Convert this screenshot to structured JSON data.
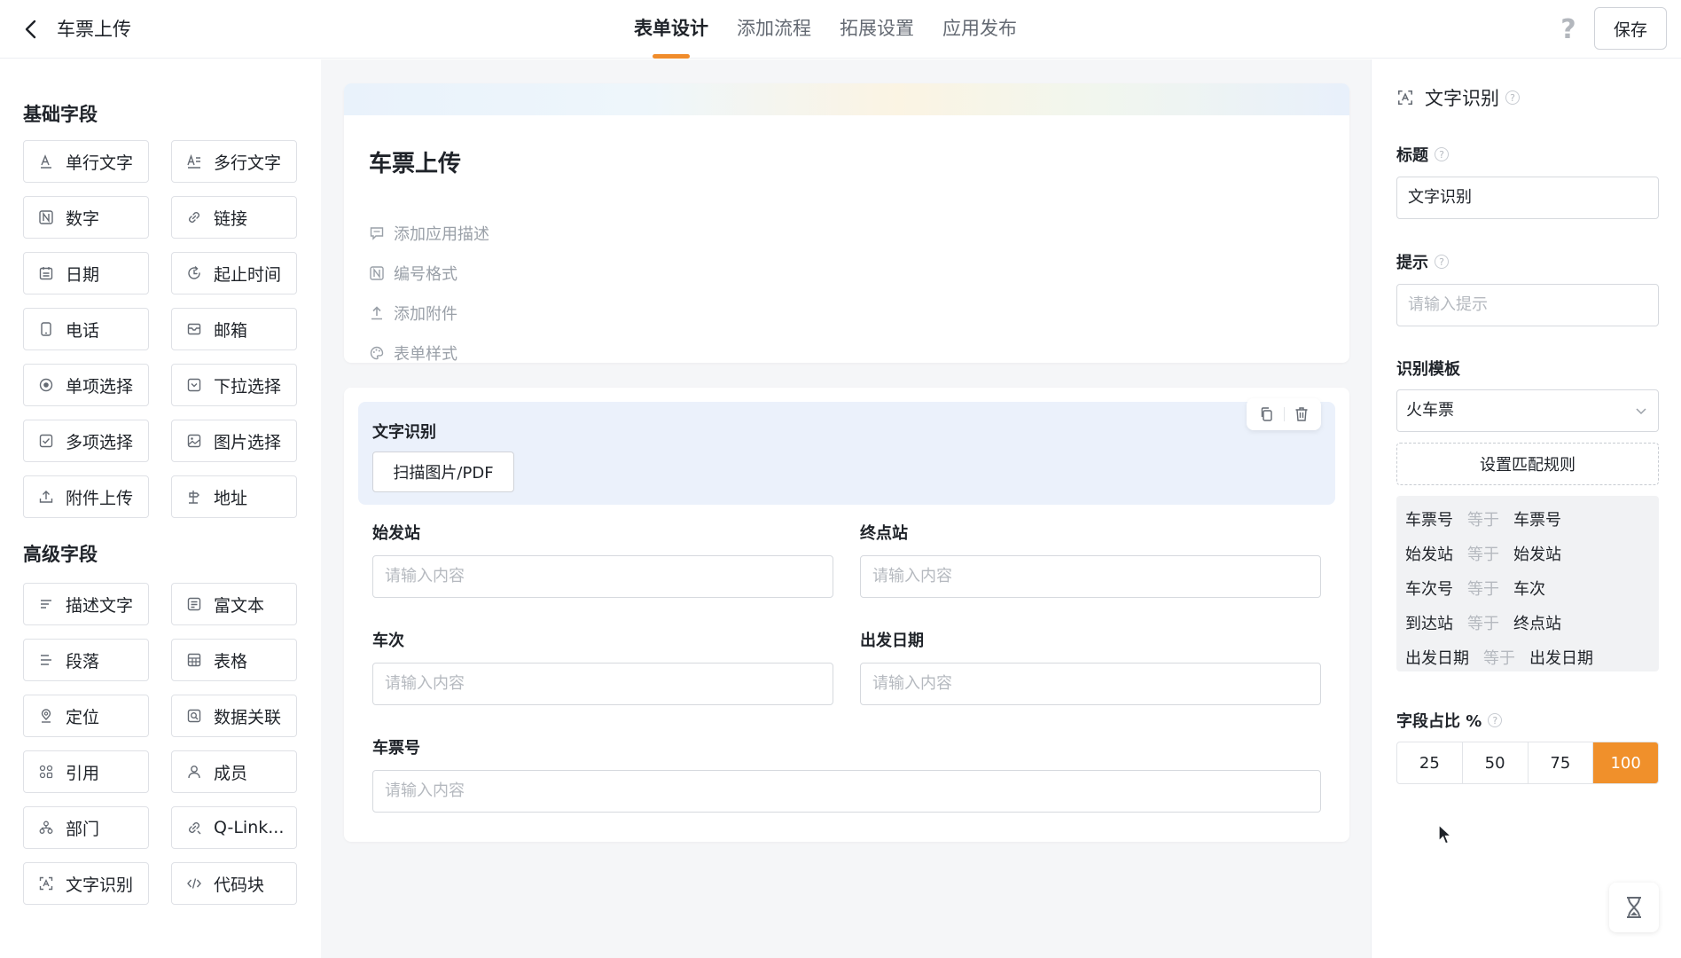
{
  "header": {
    "title": "车票上传",
    "tabs": [
      "表单设计",
      "添加流程",
      "拓展设置",
      "应用发布"
    ],
    "help": "?",
    "save_label": "保存"
  },
  "palette": {
    "basic_title": "基础字段",
    "basic": [
      {
        "label": "单行文字",
        "icon": "text-icon"
      },
      {
        "label": "多行文字",
        "icon": "multiline-text-icon"
      },
      {
        "label": "数字",
        "icon": "number-icon"
      },
      {
        "label": "链接",
        "icon": "link-icon"
      },
      {
        "label": "日期",
        "icon": "calendar-icon"
      },
      {
        "label": "起止时间",
        "icon": "time-range-icon"
      },
      {
        "label": "电话",
        "icon": "phone-icon"
      },
      {
        "label": "邮箱",
        "icon": "mail-icon"
      },
      {
        "label": "单项选择",
        "icon": "radio-icon"
      },
      {
        "label": "下拉选择",
        "icon": "dropdown-icon"
      },
      {
        "label": "多项选择",
        "icon": "checkbox-icon"
      },
      {
        "label": "图片选择",
        "icon": "image-icon"
      },
      {
        "label": "附件上传",
        "icon": "upload-icon"
      },
      {
        "label": "地址",
        "icon": "address-icon"
      }
    ],
    "advanced_title": "高级字段",
    "advanced": [
      {
        "label": "描述文字",
        "icon": "description-icon"
      },
      {
        "label": "富文本",
        "icon": "rich-text-icon"
      },
      {
        "label": "段落",
        "icon": "paragraph-icon"
      },
      {
        "label": "表格",
        "icon": "table-icon"
      },
      {
        "label": "定位",
        "icon": "location-icon"
      },
      {
        "label": "数据关联",
        "icon": "data-link-icon"
      },
      {
        "label": "引用",
        "icon": "reference-icon"
      },
      {
        "label": "成员",
        "icon": "member-icon"
      },
      {
        "label": "部门",
        "icon": "department-icon"
      },
      {
        "label": "Q-Link...",
        "icon": "q-link-icon"
      },
      {
        "label": "文字识别",
        "icon": "ocr-icon"
      },
      {
        "label": "代码块",
        "icon": "code-icon"
      }
    ]
  },
  "form": {
    "title": "车票上传",
    "meta": [
      {
        "label": "添加应用描述",
        "icon": "comment-icon"
      },
      {
        "label": "编号格式",
        "icon": "number-format-icon"
      },
      {
        "label": "添加附件",
        "icon": "attachment-icon"
      },
      {
        "label": "表单样式",
        "icon": "palette-icon"
      }
    ],
    "ocr_label": "文字识别",
    "scan_button": "扫描图片/PDF",
    "fields": [
      {
        "label": "始发站",
        "placeholder": "请输入内容"
      },
      {
        "label": "终点站",
        "placeholder": "请输入内容"
      },
      {
        "label": "车次",
        "placeholder": "请输入内容"
      },
      {
        "label": "出发日期",
        "placeholder": "请输入内容"
      },
      {
        "label": "车票号",
        "placeholder": "请输入内容"
      }
    ]
  },
  "props": {
    "heading": "文字识别",
    "title_label": "标题",
    "title_value": "文字识别",
    "hint_label": "提示",
    "hint_placeholder": "请输入提示",
    "template_label": "识别模板",
    "template_value": "火车票",
    "rule_button": "设置匹配规则",
    "rules": [
      {
        "left": "车票号",
        "op": "等于",
        "right": "车票号"
      },
      {
        "left": "始发站",
        "op": "等于",
        "right": "始发站"
      },
      {
        "left": "车次号",
        "op": "等于",
        "right": "车次"
      },
      {
        "left": "到达站",
        "op": "等于",
        "right": "终点站"
      },
      {
        "left": "出发日期",
        "op": "等于",
        "right": "出发日期"
      }
    ],
    "ratio_label": "字段占比 %",
    "ratio_options": [
      "25",
      "50",
      "75",
      "100"
    ],
    "ratio_selected": "100",
    "accent_color": "#f0902b"
  }
}
